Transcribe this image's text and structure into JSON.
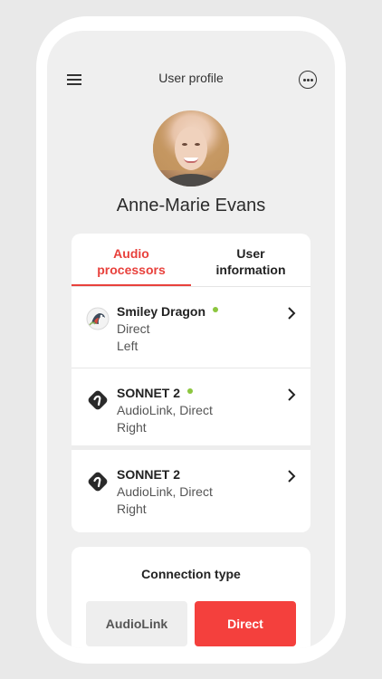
{
  "header": {
    "title": "User profile",
    "menu_icon": "hamburger-menu-icon",
    "more_icon": "more-options-icon"
  },
  "profile": {
    "name": "Anne-Marie Evans"
  },
  "tabs": [
    {
      "label_line1": "Audio",
      "label_line2": "processors",
      "active": true
    },
    {
      "label_line1": "User",
      "label_line2": "information",
      "active": false
    }
  ],
  "devices": [
    {
      "name": "Smiley Dragon",
      "line1": "Direct",
      "line2": "Left",
      "connected": true,
      "icon": "smiley-dragon-icon"
    },
    {
      "name": "SONNET 2",
      "line1": "AudioLink, Direct",
      "line2": "Right",
      "connected": true,
      "icon": "sonnet-device-icon"
    },
    {
      "name": "SONNET 2",
      "line1": "AudioLink, Direct",
      "line2": "Right",
      "connected": false,
      "icon": "sonnet-device-icon"
    }
  ],
  "connection": {
    "title": "Connection type",
    "options": [
      "AudioLink",
      "Direct"
    ],
    "selected": "Direct"
  },
  "colors": {
    "accent": "#e8413c",
    "status_connected": "#8cc63f",
    "selected_button": "#f4403d"
  }
}
